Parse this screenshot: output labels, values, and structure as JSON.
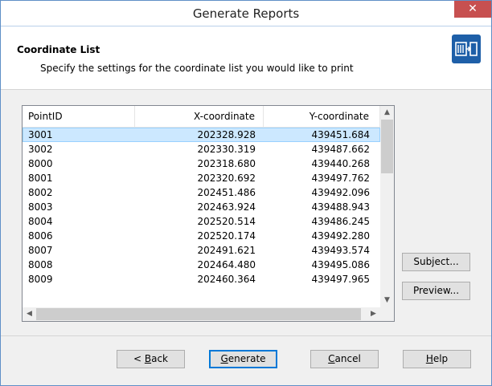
{
  "window": {
    "title": "Generate Reports",
    "close_glyph": "✕"
  },
  "header": {
    "title": "Coordinate List",
    "subtitle": "Specify the settings for the coordinate list you would like to print",
    "icon": "report-icon"
  },
  "table": {
    "columns": [
      "PointID",
      "X-coordinate",
      "Y-coordinate"
    ],
    "rows": [
      {
        "id": "3001",
        "x": "202328.928",
        "y": "439451.684"
      },
      {
        "id": "3002",
        "x": "202330.319",
        "y": "439487.662"
      },
      {
        "id": "8000",
        "x": "202318.680",
        "y": "439440.268"
      },
      {
        "id": "8001",
        "x": "202320.692",
        "y": "439497.762"
      },
      {
        "id": "8002",
        "x": "202451.486",
        "y": "439492.096"
      },
      {
        "id": "8003",
        "x": "202463.924",
        "y": "439488.943"
      },
      {
        "id": "8004",
        "x": "202520.514",
        "y": "439486.245"
      },
      {
        "id": "8006",
        "x": "202520.174",
        "y": "439492.280"
      },
      {
        "id": "8007",
        "x": "202491.621",
        "y": "439493.574"
      },
      {
        "id": "8008",
        "x": "202464.480",
        "y": "439495.086"
      },
      {
        "id": "8009",
        "x": "202460.364",
        "y": "439497.965"
      }
    ],
    "selected_index": 0
  },
  "side_buttons": {
    "subject": "Subject...",
    "preview": "Preview..."
  },
  "footer": {
    "back_pre": "< ",
    "back_key": "B",
    "back_post": "ack",
    "generate_key": "G",
    "generate_post": "enerate",
    "cancel_key": "C",
    "cancel_post": "ancel",
    "help_key": "H",
    "help_post": "elp"
  },
  "colors": {
    "accent": "#0078d7",
    "selection": "#cce8ff",
    "close": "#c75050"
  }
}
